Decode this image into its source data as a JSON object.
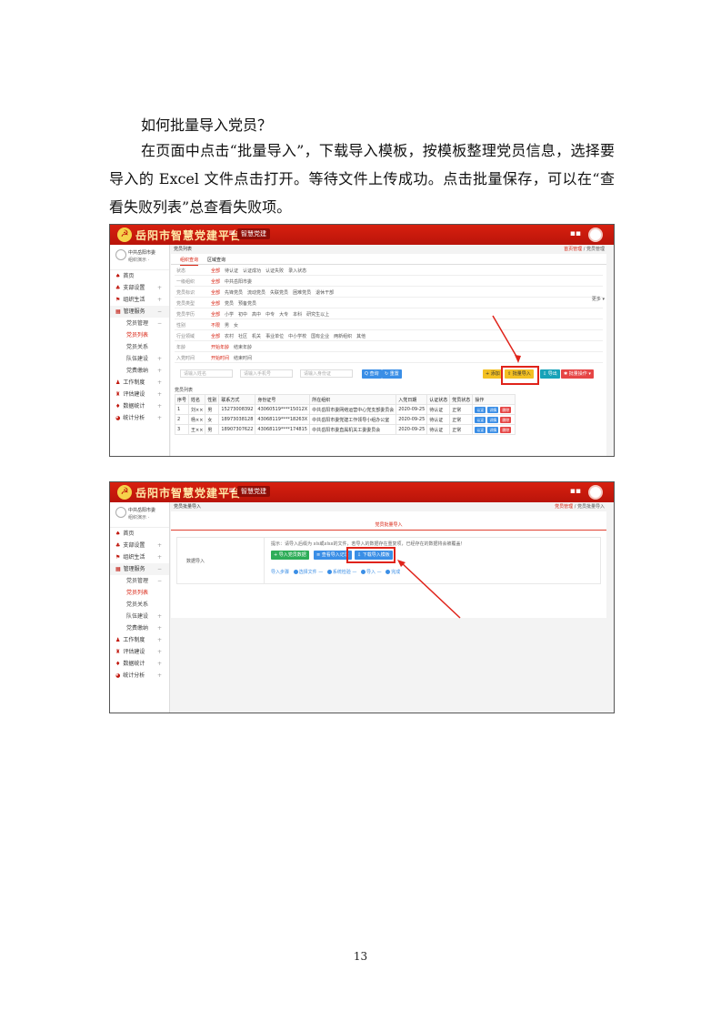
{
  "document": {
    "heading": "如何批量导入党员？",
    "paragraph": "在页面中点击“批量导入”，下载导入模板，按模板整理党员信息，选择要导入的 Excel 文件点击打开。等待文件上传成功。点击批量保存，可以在“查看失败列表”总查看失败项。",
    "page_number": "13"
  },
  "app": {
    "brand": "岳阳市智慧党建平台",
    "top_tab": "智慧党建",
    "logo_glyph": "☭",
    "user_name": "中共岳阳市委",
    "user_role": "组织演示 ·",
    "nav": [
      {
        "label": "首页",
        "icon": "home-icon",
        "glyph": "♠"
      },
      {
        "label": "支部设置",
        "icon": "org-icon",
        "glyph": "♣",
        "plus": "+"
      },
      {
        "label": "组织生活",
        "icon": "flag-icon",
        "glyph": "⚑",
        "plus": "+"
      },
      {
        "label": "管理服务",
        "icon": "grid-icon",
        "glyph": "▦",
        "plus": "−"
      },
      {
        "label": "党员管理",
        "sub": true,
        "plus": "−"
      },
      {
        "label": "党员列表",
        "sub": true,
        "active": true
      },
      {
        "label": "党员关系",
        "sub": true
      },
      {
        "label": "队伍建设",
        "sub": true,
        "plus": "+"
      },
      {
        "label": "党费缴纳",
        "sub": true,
        "plus": "+"
      },
      {
        "label": "工作制度",
        "icon": "doc-icon",
        "glyph": "♟",
        "plus": "+"
      },
      {
        "label": "评估建设",
        "icon": "chart-icon",
        "glyph": "♜",
        "plus": "+"
      },
      {
        "label": "数据统计",
        "icon": "data-icon",
        "glyph": "♦",
        "plus": "+"
      },
      {
        "label": "统计分析",
        "icon": "pie-icon",
        "glyph": "◕",
        "plus": "+"
      }
    ]
  },
  "screen1": {
    "crumb": "党员列表",
    "crumb_right_hl": "首页管理",
    "crumb_right": "党员管理",
    "tabs": [
      "组织查询",
      "区域查询"
    ],
    "filters": [
      {
        "label": "状态",
        "options": [
          "全部",
          "待认证",
          "认证成功",
          "认证失败",
          "录入状态"
        ]
      },
      {
        "label": "一级组织",
        "options": [
          "全部",
          "中共岳阳市委"
        ]
      },
      {
        "label": "党员标识",
        "options": [
          "全部",
          "先锋党员",
          "流动党员",
          "失联党员",
          "困难党员",
          "退休干部"
        ]
      },
      {
        "label": "党员类型",
        "options": [
          "全部",
          "党员",
          "预备党员"
        ]
      },
      {
        "label": "党员学历",
        "options": [
          "全部",
          "小学",
          "初中",
          "高中",
          "中专",
          "大专",
          "本科",
          "研究生以上"
        ]
      },
      {
        "label": "性别",
        "options": [
          "不限",
          "男",
          "女"
        ]
      },
      {
        "label": "行业领域",
        "options": [
          "全部",
          "农村",
          "社区",
          "机关",
          "事业单位",
          "中小学校",
          "国有企业",
          "两新组织",
          "其他"
        ]
      },
      {
        "label": "年龄",
        "options": [
          "开始年龄",
          "结束年龄"
        ]
      },
      {
        "label": "入党时间",
        "options": [
          "开始时间",
          "结束时间"
        ]
      }
    ],
    "more": "更多 ▾",
    "search": {
      "p1": "请输入姓名",
      "p2": "请输入手机号",
      "p3": "请输入身份证",
      "query": "Q 查询",
      "reset": "↻ 重置"
    },
    "buttons": {
      "add": "+ 添加",
      "import": "⇪ 批量导入",
      "export": "⇩ 导出",
      "batch": "✱ 批量操作 ▾"
    },
    "list_title": "党员列表",
    "columns": [
      "序号",
      "姓名",
      "性别",
      "联系方式",
      "身份证号",
      "所在组织",
      "入党日期",
      "认证状态",
      "党员状态",
      "操作"
    ],
    "rows": [
      [
        "1",
        "刘××",
        "男",
        "15273008392",
        "43060519****15012X",
        "中共岳阳市委网络运营中心党支部委员会",
        "2020-09-25",
        "待认证",
        "正常"
      ],
      [
        "2",
        "杨××",
        "女",
        "18973038128",
        "43068119****18263X",
        "中共岳阳市委党建工作领导小组办公室",
        "2020-09-25",
        "待认证",
        "正常"
      ],
      [
        "3",
        "王××",
        "男",
        "18907307622",
        "43068119****174815",
        "中共岳阳市委直属机关工委委员会",
        "2020-09-25",
        "待认证",
        "正常"
      ]
    ],
    "row_actions": [
      "认证",
      "详情",
      "删除"
    ]
  },
  "screen2": {
    "crumb": "党员批量导入",
    "crumb_right_hl": "党员管理",
    "crumb_right": "党员批量导入",
    "title": "党员批量导入",
    "label": "数据导入",
    "tip": "提示：请导入后缀为 xls或xlsx的文件，若导入的数据存在重复项，已经存在的数据将会被覆盖！",
    "btn_import": "+ 导入党员数据",
    "btn_record": "≡ 查看导入记录",
    "btn_template": "⇩ 下载导入模板",
    "steps_label": "导入步骤",
    "steps": [
      "选择文件",
      "系统检验",
      "导入",
      "完成"
    ]
  }
}
